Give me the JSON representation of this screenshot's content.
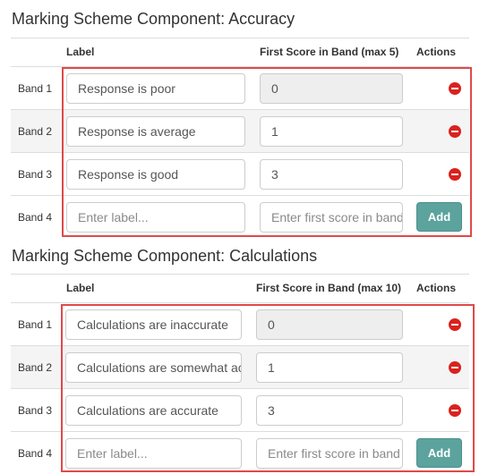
{
  "components": [
    {
      "title": "Marking Scheme Component: Accuracy",
      "headers": {
        "label": "Label",
        "score": "First Score in Band (max 5)",
        "actions": "Actions"
      },
      "bands": [
        {
          "band": "Band 1",
          "label": "Response is poor",
          "score": "0",
          "score_disabled": true,
          "action": "remove-icon"
        },
        {
          "band": "Band 2",
          "label": "Response is average",
          "score": "1",
          "action": "remove-icon"
        },
        {
          "band": "Band 3",
          "label": "Response is good",
          "score": "3",
          "action": "remove-icon"
        }
      ],
      "new_band": {
        "band": "Band 4",
        "label_placeholder": "Enter label...",
        "score_placeholder": "Enter first score in band",
        "add_label": "Add"
      }
    },
    {
      "title": "Marking Scheme Component: Calculations",
      "headers": {
        "label": "Label",
        "score": "First Score in Band (max 10)",
        "actions": "Actions"
      },
      "bands": [
        {
          "band": "Band 1",
          "label": "Calculations are inaccurate",
          "score": "0",
          "score_disabled": true,
          "action": "remove-icon"
        },
        {
          "band": "Band 2",
          "label": "Calculations are somewhat accurate",
          "score": "1",
          "action": "remove-icon"
        },
        {
          "band": "Band 3",
          "label": "Calculations are accurate",
          "score": "3",
          "action": "remove-icon"
        }
      ],
      "new_band": {
        "band": "Band 4",
        "label_placeholder": "Enter label...",
        "score_placeholder": "Enter first score in band",
        "add_label": "Add"
      }
    }
  ],
  "colors": {
    "remove": "#d9221e",
    "add_button": "#5ca39e",
    "highlight": "#e0494a",
    "stripe": "#f4f4f4"
  }
}
